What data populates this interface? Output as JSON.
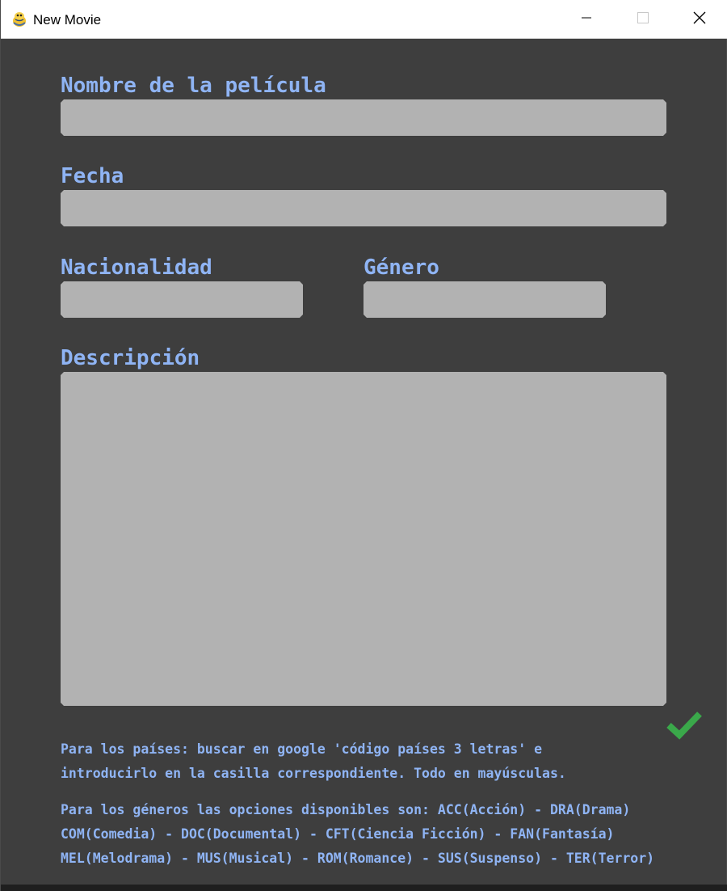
{
  "window": {
    "title": "New Movie"
  },
  "form": {
    "name_label": "Nombre de la película",
    "name_value": "",
    "date_label": "Fecha",
    "date_value": "",
    "nationality_label": "Nacionalidad",
    "nationality_value": "",
    "genre_label": "Género",
    "genre_value": "",
    "description_label": "Descripción",
    "description_value": ""
  },
  "help": {
    "countries_line1": "Para los países: buscar en google 'código países 3 letras' e",
    "countries_line2": "introducirlo en la casilla correspondiente. Todo en mayúsculas.",
    "genres_line1": "Para los géneros las opciones disponibles son: ACC(Acción) - DRA(Drama)",
    "genres_line2": "COM(Comedia) - DOC(Documental) - CFT(Ciencia Ficción) - FAN(Fantasía)",
    "genres_line3": "MEL(Melodrama) - MUS(Musical) - ROM(Romance) - SUS(Suspenso) - TER(Terror)"
  },
  "icons": {
    "app": "pygame-snake-icon",
    "minimize": "minimize-icon",
    "maximize": "maximize-icon",
    "close": "close-icon",
    "submit": "checkmark-icon"
  },
  "colors": {
    "background": "#3e3e3e",
    "label": "#8fb4f4",
    "field": "#b2b2b2",
    "check": "#3aa84a"
  }
}
